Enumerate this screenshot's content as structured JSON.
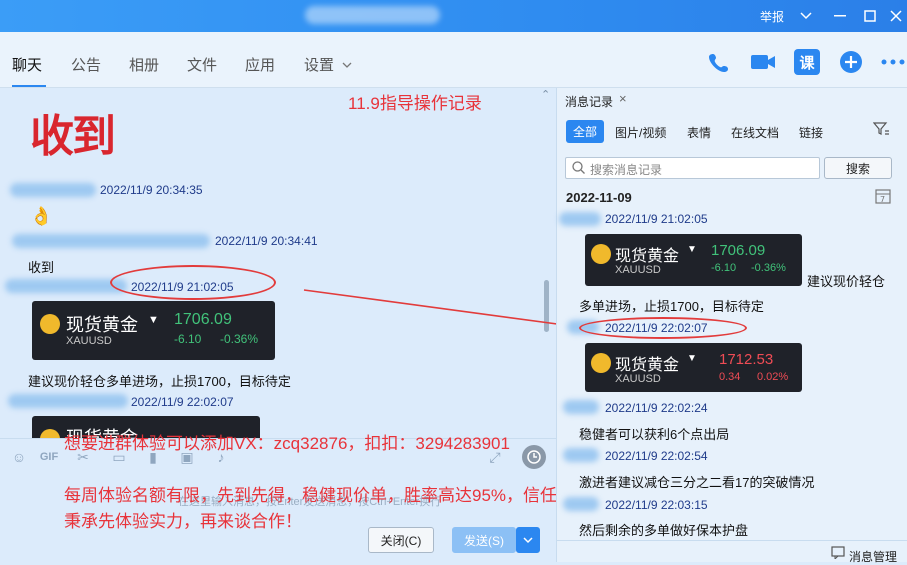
{
  "titlebar": {
    "report": "举报"
  },
  "tabs": [
    {
      "label": "聊天"
    },
    {
      "label": "公告"
    },
    {
      "label": "相册"
    },
    {
      "label": "文件"
    },
    {
      "label": "应用"
    },
    {
      "label": "设置"
    }
  ],
  "toolbar": {
    "lesson_label": "课"
  },
  "chat": {
    "sticker_text": "收到",
    "messages": [
      {
        "time": "2022/11/9 20:34:35",
        "text": "👌"
      },
      {
        "time": "2022/11/9 20:34:41",
        "text": "收到"
      },
      {
        "time": "2022/11/9 21:02:05",
        "text": "建议现价轻仓多单进场，止损1700，目标待定"
      },
      {
        "time": "2022/11/9 22:02:07",
        "text": ""
      }
    ],
    "card1": {
      "name": "现货黄金",
      "symbol": "XAUUSD",
      "price": "1706.09",
      "change": "-6.10",
      "pct": "-0.36%"
    },
    "card2": {
      "name": "现货黄金"
    }
  },
  "overlay": {
    "title": "11.9指导操作记录",
    "line1": "想要进群体验可以添加VX：zcq32876，扣扣：3294283901",
    "line2": "每周体验名额有限，先到先得，稳健现价单，胜率高达95%，信任是基础，实力才是关键！张彦溱",
    "line3": "秉承先体验实力，再来谈合作！"
  },
  "input": {
    "close_label": "关闭(C)",
    "send_label": "发送(S)",
    "hint": "在这里输入消息，按Enter发送消息，按Ctrl+Enter换行"
  },
  "history": {
    "tab_label": "消息记录",
    "filters": [
      "全部",
      "图片/视频",
      "表情",
      "在线文档",
      "链接"
    ],
    "search_placeholder": "搜索消息记录",
    "search_button": "搜索",
    "date": "2022-11-09",
    "entries": [
      {
        "time": "2022/11/9 21:02:05",
        "text": "建议现价轻仓"
      },
      {
        "time": "",
        "text": "多单进场，止损1700，目标待定"
      },
      {
        "time": "2022/11/9 22:02:07",
        "text": ""
      },
      {
        "time": "2022/11/9 22:02:24",
        "text": "稳健者可以获利6个点出局"
      },
      {
        "time": "2022/11/9 22:02:54",
        "text": "激进者建议减仓三分之二看17的突破情况"
      },
      {
        "time": "2022/11/9 22:03:15",
        "text": "然后剩余的多单做好保本护盘"
      }
    ],
    "card1": {
      "name": "现货黄金",
      "symbol": "XAUUSD",
      "price": "1706.09",
      "change": "-6.10",
      "pct": "-0.36%"
    },
    "card2": {
      "name": "现货黄金",
      "symbol": "XAUUSD",
      "price": "1712.53",
      "change": "0.34",
      "pct": "0.02%"
    },
    "manage_label": "消息管理"
  },
  "colors": {
    "accent": "#2b87f0",
    "annotation": "#e23b3b",
    "up": "#41c27a",
    "down": "#ef4c55"
  }
}
